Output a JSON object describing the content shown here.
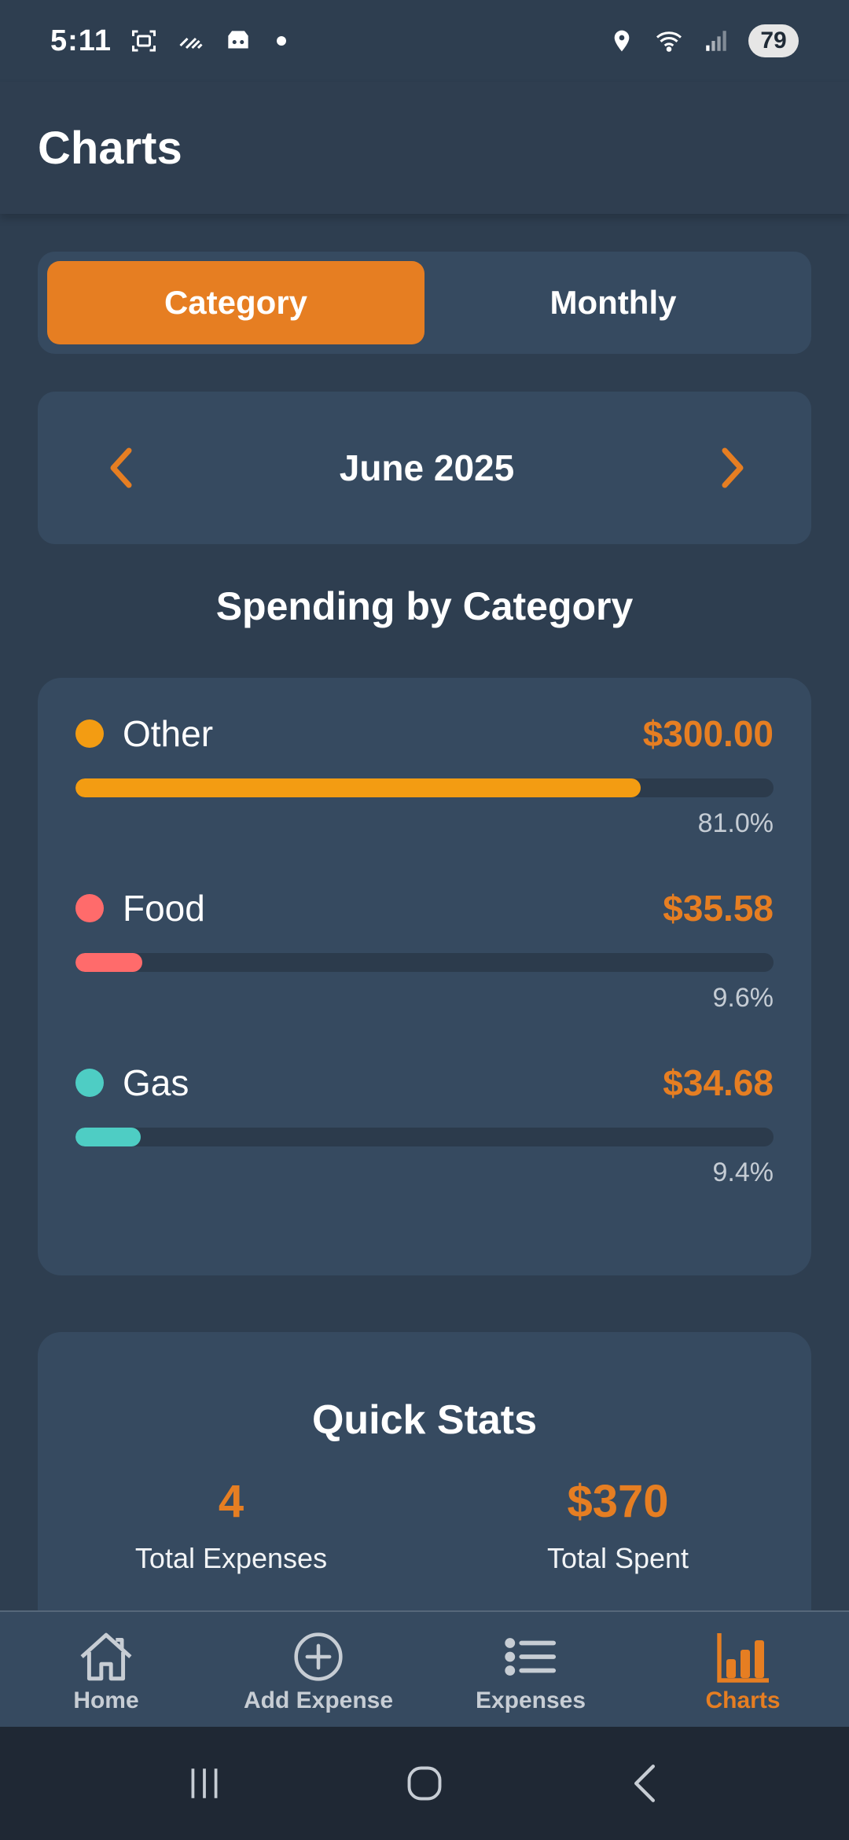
{
  "status_bar": {
    "time": "5:11",
    "battery": "79",
    "icons": [
      "screenshot-icon",
      "signal-lines-icon",
      "game-icon",
      "notification-dot",
      "location-icon",
      "wifi-icon",
      "cell-signal-icon"
    ]
  },
  "header": {
    "title": "Charts"
  },
  "tabs": [
    {
      "label": "Category",
      "active": true
    },
    {
      "label": "Monthly",
      "active": false
    }
  ],
  "month_selector": {
    "label": "June 2025",
    "prev_icon": "chevron-left-icon",
    "next_icon": "chevron-right-icon"
  },
  "section_title": "Spending by Category",
  "chart_data": {
    "type": "bar",
    "title": "Spending by Category",
    "categories": [
      "Other",
      "Food",
      "Gas"
    ],
    "values": [
      300.0,
      35.58,
      34.68
    ],
    "percentages": [
      81.0,
      9.6,
      9.4
    ],
    "colors": [
      "#f39c12",
      "#ff6b6b",
      "#4ecdc4"
    ]
  },
  "categories": [
    {
      "name": "Other",
      "amount": "$300.00",
      "percent": "81.0%",
      "share": 0.81,
      "color": "#f39c12"
    },
    {
      "name": "Food",
      "amount": "$35.58",
      "percent": "9.6%",
      "share": 0.096,
      "color": "#ff6b6b"
    },
    {
      "name": "Gas",
      "amount": "$34.68",
      "percent": "9.4%",
      "share": 0.094,
      "color": "#4ecdc4"
    }
  ],
  "quick_stats": {
    "title": "Quick Stats",
    "total_expenses_value": "4",
    "total_expenses_label": "Total Expenses",
    "total_spent_value": "$370",
    "total_spent_label": "Total Spent"
  },
  "bottom_nav": [
    {
      "label": "Home",
      "icon": "home-icon",
      "active": false
    },
    {
      "label": "Add Expense",
      "icon": "add-circle-icon",
      "active": false
    },
    {
      "label": "Expenses",
      "icon": "list-icon",
      "active": false
    },
    {
      "label": "Charts",
      "icon": "bar-chart-icon",
      "active": true
    }
  ],
  "system_nav": [
    "recents-icon",
    "home-circle-icon",
    "back-icon"
  ],
  "colors": {
    "accent": "#e67e22",
    "background": "#2e3e50",
    "card": "#364a60"
  }
}
